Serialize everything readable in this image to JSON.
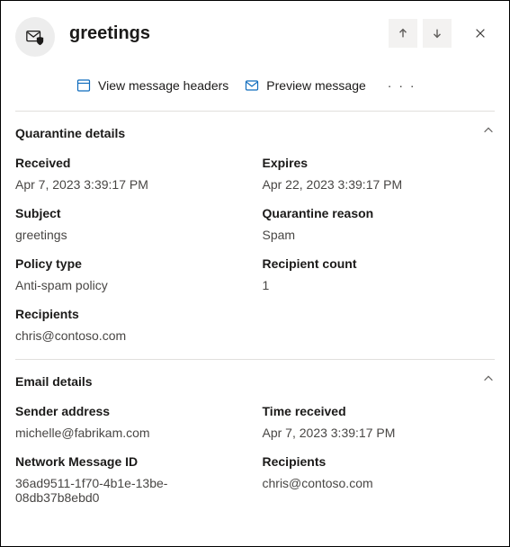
{
  "header": {
    "title": "greetings"
  },
  "actions": {
    "view_headers": "View message headers",
    "preview": "Preview message"
  },
  "sections": {
    "quarantine": {
      "title": "Quarantine details",
      "received_label": "Received",
      "received_value": "Apr 7, 2023 3:39:17 PM",
      "expires_label": "Expires",
      "expires_value": "Apr 22, 2023 3:39:17 PM",
      "subject_label": "Subject",
      "subject_value": "greetings",
      "reason_label": "Quarantine reason",
      "reason_value": "Spam",
      "policy_label": "Policy type",
      "policy_value": "Anti-spam policy",
      "count_label": "Recipient count",
      "count_value": "1",
      "recipients_label": "Recipients",
      "recipients_value": "chris@contoso.com"
    },
    "email": {
      "title": "Email details",
      "sender_label": "Sender address",
      "sender_value": "michelle@fabrikam.com",
      "time_label": "Time received",
      "time_value": "Apr 7, 2023 3:39:17 PM",
      "msgid_label": "Network Message ID",
      "msgid_value": "36ad9511-1f70-4b1e-13be-08db37b8ebd0",
      "recipients_label": "Recipients",
      "recipients_value": "chris@contoso.com"
    }
  }
}
